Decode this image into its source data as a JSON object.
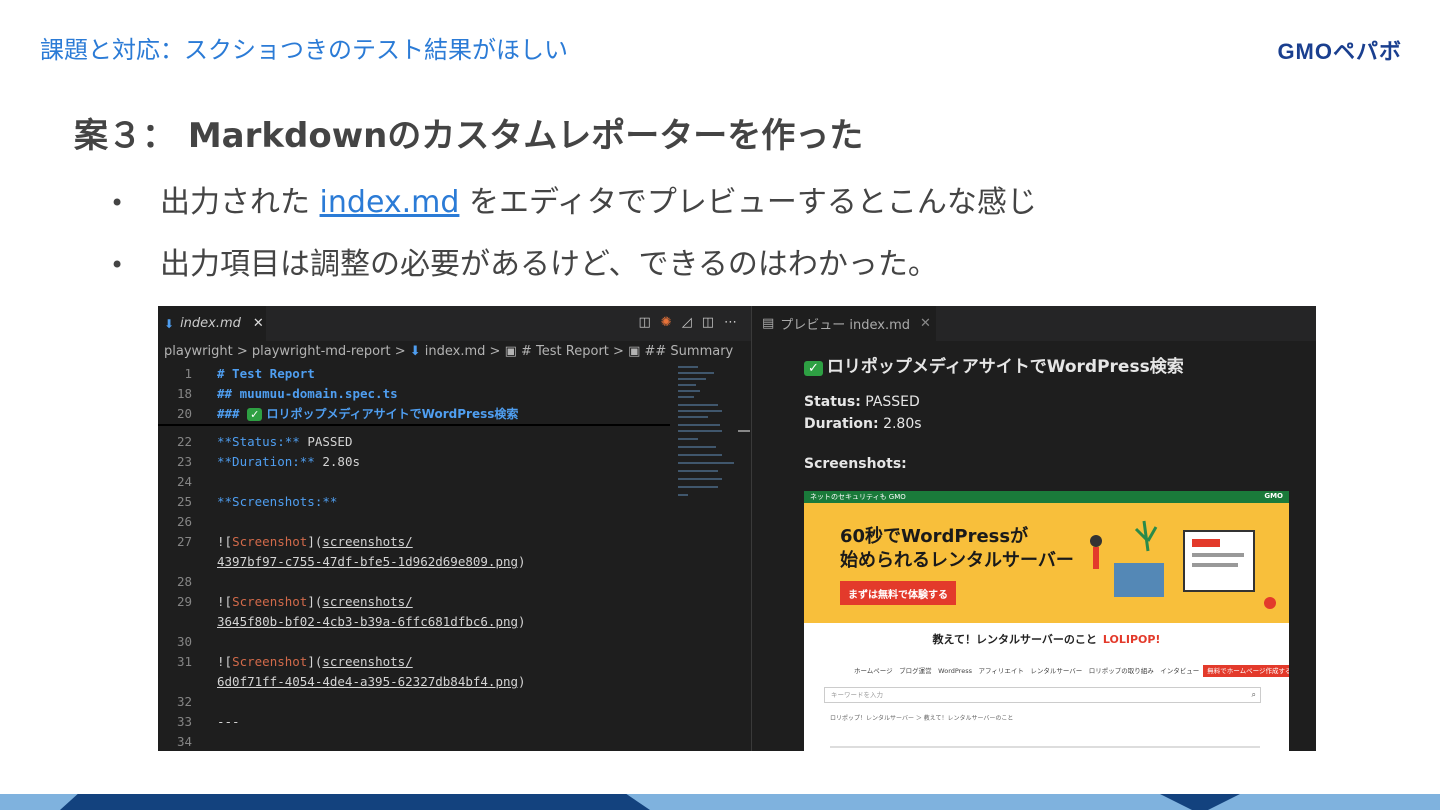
{
  "slide": {
    "header": "課題と対応：スクショつきのテスト結果がほしい",
    "logo": "GMOペパボ",
    "title": "案３： Markdownのカスタムレポーターを作った",
    "bullet1_before": "出力された ",
    "bullet1_link": "index.md",
    "bullet1_after": " をエディタでプレビューするとこんな感じ",
    "bullet2": "出力項目は調整の必要があるけど、できるのはわかった。"
  },
  "editor": {
    "tab_label": "index.md",
    "tab_close": "✕",
    "breadcrumb": {
      "p1": "playwright",
      "p2": "playwright-md-report",
      "p3": "index.md",
      "p4": "# Test Report",
      "p5": "## Summary"
    },
    "lines": {
      "n1": "1",
      "t1": "# Test Report",
      "n18": "18",
      "t18": "## muumuu-domain.spec.ts",
      "n20": "20",
      "t20a": "### ",
      "t20b": "✓",
      "t20c": " ロリポップメディアサイトでWordPress検索",
      "n22": "22",
      "t22a": "**Status:**",
      "t22b": " PASSED",
      "n23": "23",
      "t23a": "**Duration:**",
      "t23b": " 2.80s",
      "n24": "24",
      "n25": "25",
      "t25": "**Screenshots:**",
      "n26": "26",
      "n27": "27",
      "t27a": "![",
      "t27b": "Screenshot",
      "t27c": "](",
      "t27d": "screenshots/",
      "t27e": "4397bf97-c755-47df-bfe5-1d962d69e809.png",
      "t27f": ")",
      "n28": "28",
      "n29": "29",
      "t29a": "![",
      "t29b": "Screenshot",
      "t29c": "](",
      "t29d": "screenshots/",
      "t29e": "3645f80b-bf02-4cb3-b39a-6ffc681dfbc6.png",
      "t29f": ")",
      "n30": "30",
      "n31": "31",
      "t31a": "![",
      "t31b": "Screenshot",
      "t31c": "](",
      "t31d": "screenshots/",
      "t31e": "6d0f71ff-4054-4de4-a395-62327db84bf4.png",
      "t31f": ")",
      "n32": "32",
      "n33": "33",
      "t33": "---",
      "n34": "34"
    }
  },
  "preview": {
    "tab_label": "プレビュー index.md",
    "tab_close": "✕",
    "check": "✓",
    "title": "ロリポップメディアサイトでWordPress検索",
    "status_label": "Status:",
    "status_value": " PASSED",
    "duration_label": "Duration:",
    "duration_value": " 2.80s",
    "screenshots_label": "Screenshots:",
    "site": {
      "top_left": "ネットのセキュリティも GMO",
      "top_right": "GMO",
      "hero_line1": "60秒でWordPressが",
      "hero_line2": "始められるレンタルサーバー",
      "hero_button": "まずは無料で体験する",
      "mid_heading": "教えて！レンタルサーバーのこと",
      "mid_logo": "LOLIPOP!",
      "nav": "ホームページ　ブログ運営　WordPress　アフィリエイト　レンタルサーバー　ロリポップの取り組み　インタビュー",
      "nav_cta": "無料でホームページ作成する",
      "search_placeholder": "キーワードを入力",
      "crumb": "ロリポップ！レンタルサーバー ＞ 教えて！レンタルサーバーのこと"
    }
  }
}
